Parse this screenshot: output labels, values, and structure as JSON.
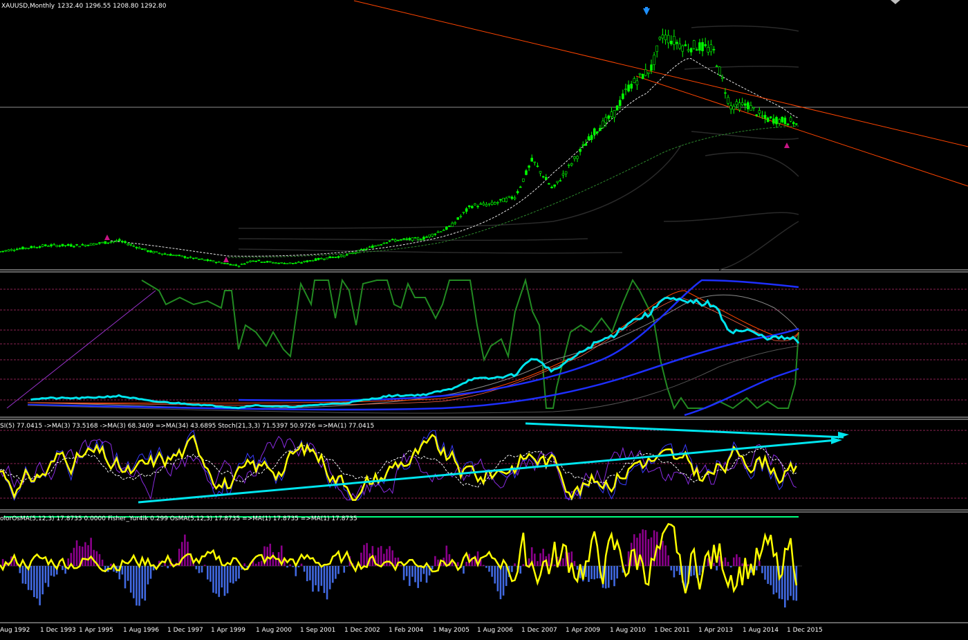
{
  "window": {
    "symbol_header": "XAUUSD,Monthly",
    "ohlc": "1232.40 1296.55 1208.80 1292.80"
  },
  "indicators": {
    "rsi_label": "SI(5) 77.0415  ->MA(3) 73.5168  ->MA(3) 68.3409  =>MA(34) 43.6895  Stoch(21,3,3) 71.5397 50.9726  =>MA(1) 77.0415",
    "osma_label": "olorOsMA(5,12,3) 17.8735 0.0000  Fisher_Yur4ik 0.299  OsMA(5,12,3) 17.8735  =>MA(1) 17.8735  =>MA(1) 17.8735"
  },
  "colors": {
    "background": "#000000",
    "bull_candle": "#00ff00",
    "price_outline": "#66ff66",
    "channel": "#ff4500",
    "rsi_line": "#ffff00",
    "trendline": "#00e5ee",
    "hist_pos": "#8b008b",
    "hist_neg": "#4169e1",
    "stoch_line": "#228b22",
    "ma_blue": "#1e2fff",
    "level_line": "#00ff7f"
  },
  "chart_data": {
    "type": "line",
    "title": "XAUUSD,Monthly",
    "x_labels": [
      "Aug 1992",
      "1 Dec 1993",
      "1 Apr 1995",
      "1 Aug 1996",
      "1 Dec 1997",
      "1 Apr 1999",
      "1 Aug 2000",
      "1 Sep 2001",
      "1 Dec 2002",
      "1 Feb 2004",
      "1 May 2005",
      "1 Aug 2006",
      "1 Dec 2007",
      "1 Apr 2009",
      "1 Aug 2010",
      "1 Dec 2011",
      "1 Apr 2013",
      "1 Aug 2014",
      "1 Dec 2015"
    ],
    "price_series": {
      "name": "XAUUSD",
      "x": [
        1992.6,
        1993.0,
        1994.0,
        1995.0,
        1996.1,
        1997.0,
        1997.6,
        1998.5,
        1999.6,
        2000.0,
        2000.7,
        2001.3,
        2002.0,
        2002.7,
        2003.3,
        2004.0,
        2005.0,
        2005.8,
        2006.4,
        2007.0,
        2007.7,
        2008.2,
        2008.8,
        2009.5,
        2010.0,
        2010.6,
        2011.0,
        2011.7,
        2012.0,
        2012.7,
        2013.0,
        2013.5,
        2014.0,
        2014.5,
        2015.0,
        2015.9,
        2016.1
      ],
      "y": [
        345,
        360,
        385,
        385,
        415,
        345,
        325,
        295,
        255,
        290,
        272,
        270,
        300,
        318,
        360,
        415,
        430,
        505,
        640,
        650,
        700,
        935,
        745,
        960,
        1110,
        1235,
        1400,
        1530,
        1740,
        1660,
        1670,
        1640,
        1280,
        1290,
        1200,
        1180,
        1060,
        1275,
        1292.8
      ]
    },
    "rsi_panel": {
      "name": "SI(5)",
      "last_value": 77.0415,
      "ma3": 73.5168,
      "ma3b": 68.3409,
      "ma34": 43.6895,
      "stoch_k": 71.5397,
      "stoch_d": 50.9726
    },
    "osma_panel": {
      "name": "olorOsMA(5,12,3)",
      "last_value": 17.8735,
      "fisher": 0.299
    },
    "grid": false,
    "legend": "none"
  }
}
